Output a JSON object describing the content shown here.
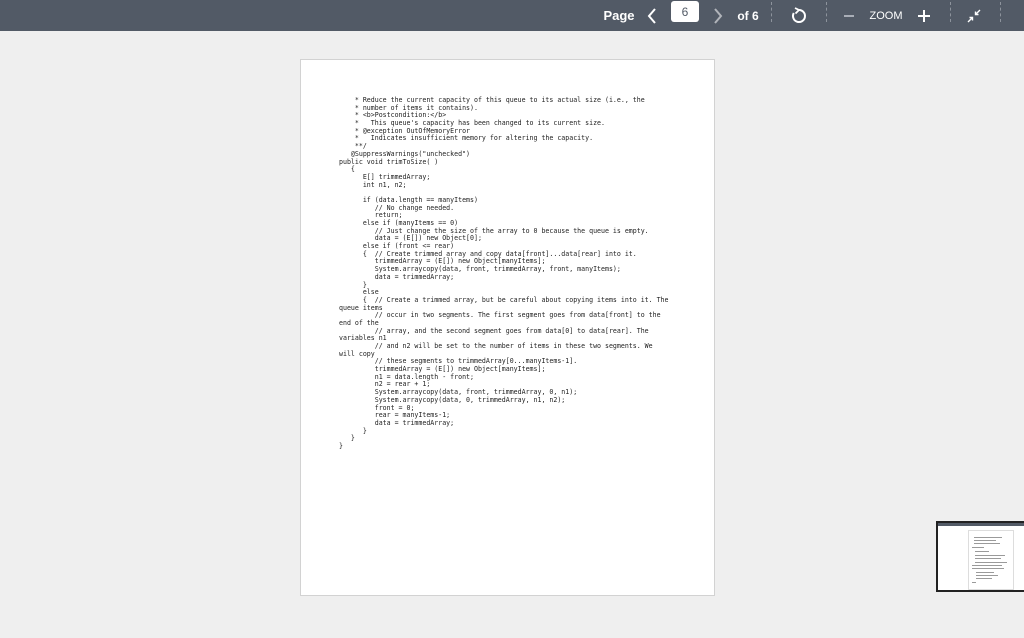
{
  "toolbar": {
    "page_label": "Page",
    "current_page": "6",
    "total_pages": "of 6",
    "zoom_label": "ZOOM"
  },
  "icons": {
    "prev": "chevron-left-icon",
    "next": "chevron-right-icon",
    "rotate": "rotate-icon",
    "zoom_out": "minus-icon",
    "zoom_in": "plus-icon",
    "fit": "collapse-icon"
  },
  "colors": {
    "toolbar_bg": "#525a66",
    "viewer_bg": "#efefef",
    "page_bg": "#ffffff"
  },
  "document": {
    "code_text": "    * Reduce the current capacity of this queue to its actual size (i.e., the\n    * number of items it contains).\n    * <b>Postcondition:</b>\n    *   This queue's capacity has been changed to its current size.\n    * @exception OutOfMemoryError\n    *   Indicates insufficient memory for altering the capacity.\n    **/\n   @SuppressWarnings(\"unchecked\")\npublic void trimToSize( )\n   {\n      E[] trimmedArray;\n      int n1, n2;\n\n      if (data.length == manyItems)\n         // No change needed.\n         return;\n      else if (manyItems == 0)\n         // Just change the size of the array to 0 because the queue is empty.\n         data = (E[]) new Object[0];\n      else if (front <= rear)\n      {  // Create trimmed array and copy data[front]...data[rear] into it.\n         trimmedArray = (E[]) new Object[manyItems];\n         System.arraycopy(data, front, trimmedArray, front, manyItems);\n         data = trimmedArray;\n      }\n      else\n      {  // Create a trimmed array, but be careful about copying items into it. The\nqueue items\n         // occur in two segments. The first segment goes from data[front] to the\nend of the\n         // array, and the second segment goes from data[0] to data[rear]. The\nvariables n1\n         // and n2 will be set to the number of items in these two segments. We\nwill copy\n         // these segments to trimmedArray[0...manyItems-1].\n         trimmedArray = (E[]) new Object[manyItems];\n         n1 = data.length - front;\n         n2 = rear + 1;\n         System.arraycopy(data, front, trimmedArray, 0, n1);\n         System.arraycopy(data, 0, trimmedArray, n1, n2);\n         front = 0;\n         rear = manyItems-1;\n         data = trimmedArray;\n      }\n   }\n}"
  }
}
